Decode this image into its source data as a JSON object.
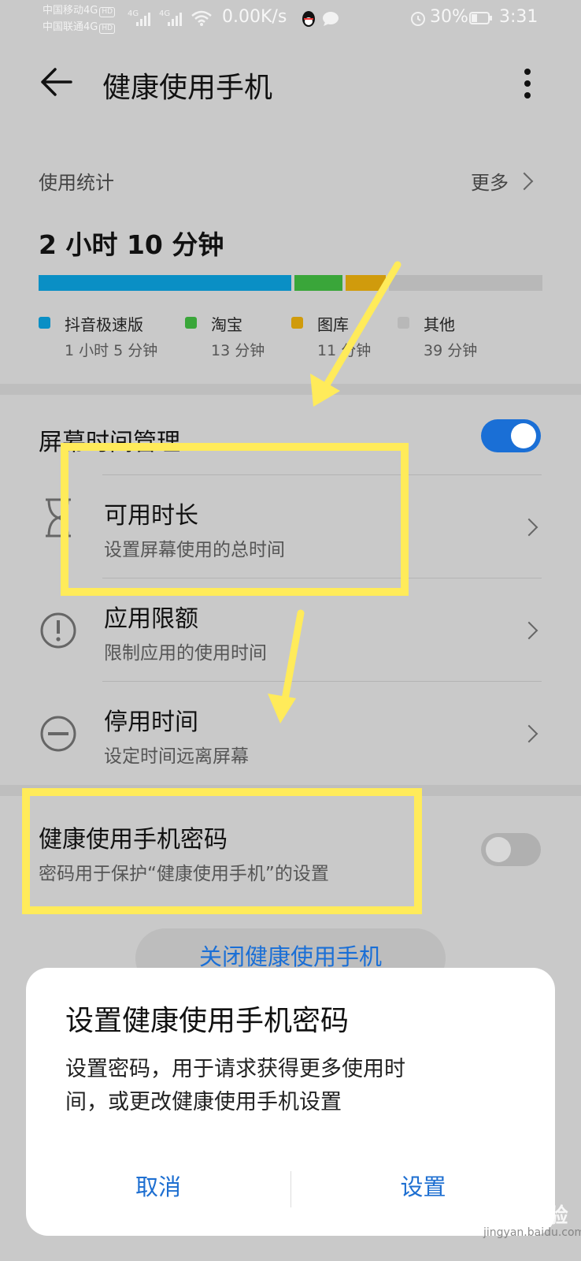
{
  "status_bar": {
    "carrier1": "中国移动4G",
    "carrier2": "中国联通4G",
    "hd": "HD",
    "net1": "4G",
    "net2": "4G",
    "speed": "0.00K/s",
    "battery": "30%",
    "time": "3:31"
  },
  "header": {
    "title": "健康使用手机"
  },
  "usage": {
    "label": "使用统计",
    "more": "更多",
    "total": "2 小时 10 分钟",
    "apps": [
      {
        "name": "抖音极速版",
        "time": "1 小时 5 分钟",
        "minutes": 65,
        "color": "#0a8fc5"
      },
      {
        "name": "淘宝",
        "time": "13 分钟",
        "minutes": 13,
        "color": "#3aa63a"
      },
      {
        "name": "图库",
        "time": "11 分钟",
        "minutes": 11,
        "color": "#d09b0c"
      },
      {
        "name": "其他",
        "time": "39 分钟",
        "minutes": 39,
        "color": "#b8b8b8"
      }
    ]
  },
  "screen_time": {
    "title": "屏幕时间管理",
    "enabled": true,
    "accent": "#1a6fd6",
    "items": [
      {
        "title": "可用时长",
        "subtitle": "设置屏幕使用的总时间",
        "icon": "hourglass-icon"
      },
      {
        "title": "应用限额",
        "subtitle": "限制应用的使用时间",
        "icon": "exclamation-icon"
      },
      {
        "title": "停用时间",
        "subtitle": "设定时间远离屏幕",
        "icon": "minus-circle-icon"
      }
    ]
  },
  "password": {
    "title": "健康使用手机密码",
    "subtitle": "密码用于保护“健康使用手机”的设置",
    "enabled": false
  },
  "close_button": "关闭健康使用手机",
  "dialog": {
    "title": "设置健康使用手机密码",
    "message_line1": "设置密码，用于请求获得更多使用时",
    "message_line2": "间，或更改健康使用手机设置",
    "cancel": "取消",
    "confirm": "设置"
  },
  "watermark": {
    "brand": "Bai du 经验",
    "url": "jingyan.baidu.com"
  },
  "annotation_color": "#ffeb5a"
}
